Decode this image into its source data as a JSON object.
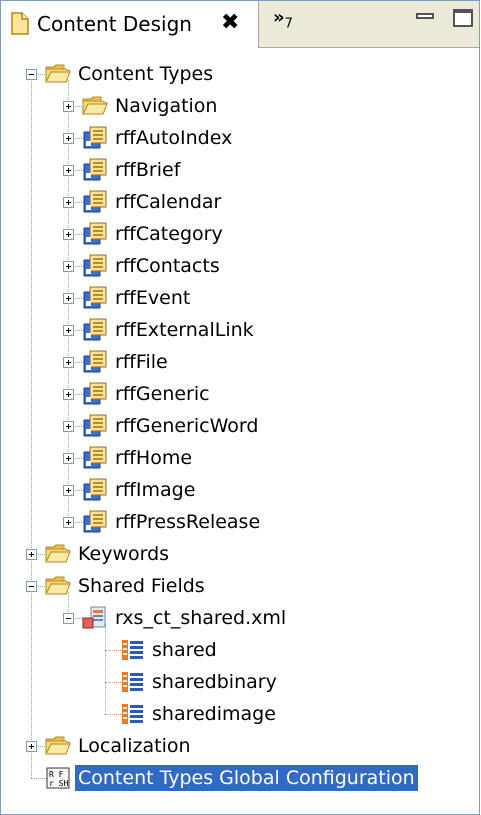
{
  "tab": {
    "title": "Content Design",
    "close_glyph": "✖",
    "overflow_glyph": "»",
    "overflow_count": "7"
  },
  "tree": [
    {
      "label": "Content Types",
      "icon": "folder-open-icon",
      "level": 0,
      "toggle": "minus"
    },
    {
      "label": "Navigation",
      "icon": "folder-open-icon",
      "level": 1,
      "toggle": "plus"
    },
    {
      "label": "rffAutoIndex",
      "icon": "content-type-icon",
      "level": 1,
      "toggle": "plus"
    },
    {
      "label": "rffBrief",
      "icon": "content-type-icon",
      "level": 1,
      "toggle": "plus"
    },
    {
      "label": "rffCalendar",
      "icon": "content-type-icon",
      "level": 1,
      "toggle": "plus"
    },
    {
      "label": "rffCategory",
      "icon": "content-type-icon",
      "level": 1,
      "toggle": "plus"
    },
    {
      "label": "rffContacts",
      "icon": "content-type-icon",
      "level": 1,
      "toggle": "plus"
    },
    {
      "label": "rffEvent",
      "icon": "content-type-icon",
      "level": 1,
      "toggle": "plus"
    },
    {
      "label": "rffExternalLink",
      "icon": "content-type-icon",
      "level": 1,
      "toggle": "plus"
    },
    {
      "label": "rffFile",
      "icon": "content-type-icon",
      "level": 1,
      "toggle": "plus"
    },
    {
      "label": "rffGeneric",
      "icon": "content-type-icon",
      "level": 1,
      "toggle": "plus"
    },
    {
      "label": "rffGenericWord",
      "icon": "content-type-icon",
      "level": 1,
      "toggle": "plus"
    },
    {
      "label": "rffHome",
      "icon": "content-type-icon",
      "level": 1,
      "toggle": "plus"
    },
    {
      "label": "rffImage",
      "icon": "content-type-icon",
      "level": 1,
      "toggle": "plus"
    },
    {
      "label": "rffPressRelease",
      "icon": "content-type-icon",
      "level": 1,
      "toggle": "plus"
    },
    {
      "label": "Keywords",
      "icon": "folder-open-icon",
      "level": 0,
      "toggle": "plus"
    },
    {
      "label": "Shared Fields",
      "icon": "folder-open-icon",
      "level": 0,
      "toggle": "minus"
    },
    {
      "label": "rxs_ct_shared.xml",
      "icon": "xml-file-icon",
      "level": 1,
      "toggle": "minus"
    },
    {
      "label": "shared",
      "icon": "field-group-icon",
      "level": 2,
      "toggle": "none"
    },
    {
      "label": "sharedbinary",
      "icon": "field-group-icon",
      "level": 2,
      "toggle": "none"
    },
    {
      "label": "sharedimage",
      "icon": "field-group-icon",
      "level": 2,
      "toggle": "none"
    },
    {
      "label": "Localization",
      "icon": "folder-open-icon",
      "level": 0,
      "toggle": "plus"
    },
    {
      "label": "Content Types Global Configuration",
      "icon": "global-config-icon",
      "level": 0,
      "toggle": "none",
      "selected": true
    }
  ],
  "colors": {
    "selection": "#316ac5",
    "folder": "#f3d36b",
    "tab_bar": "#ece9d8"
  }
}
